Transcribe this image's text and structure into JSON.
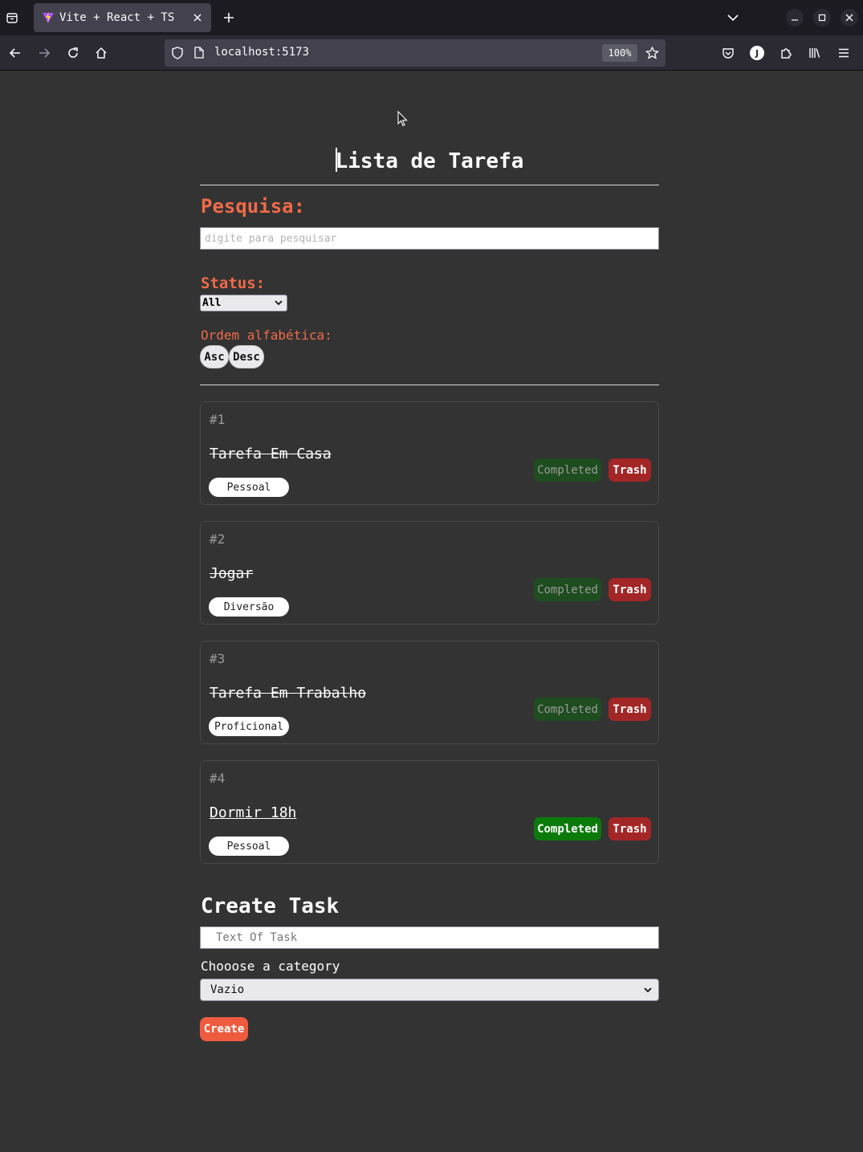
{
  "browser": {
    "tab_title": "Vite + React + TS",
    "url": "localhost:5173",
    "zoom": "100%",
    "account_initial": "J"
  },
  "page": {
    "title": "Lista de Tarefa",
    "search": {
      "label": "Pesquisa:",
      "placeholder": "digite para pesquisar",
      "value": ""
    },
    "status": {
      "label": "Status:",
      "selected": "All"
    },
    "sort": {
      "label": "Ordem alfabética:",
      "asc": "Asc",
      "desc": "Desc"
    },
    "tasks": [
      {
        "num": "#1",
        "title": "Tarefa Em Casa",
        "category": "Pessoal",
        "completed_label": "Completed",
        "trash_label": "Trash",
        "completed": true
      },
      {
        "num": "#2",
        "title": "Jogar",
        "category": "Diversão",
        "completed_label": "Completed",
        "trash_label": "Trash",
        "completed": true
      },
      {
        "num": "#3",
        "title": "Tarefa Em Trabalho",
        "category": "Proficional",
        "completed_label": "Completed",
        "trash_label": "Trash",
        "completed": true
      },
      {
        "num": "#4",
        "title": "Dormir 18h",
        "category": "Pessoal",
        "completed_label": "Completed",
        "trash_label": "Trash",
        "completed": false
      }
    ],
    "create": {
      "title": "Create Task",
      "input_placeholder": "Text Of Task",
      "category_label": "Chooose a category",
      "category_selected": "Vazio",
      "button": "Create"
    }
  },
  "colors": {
    "page_bg": "#333333",
    "accent_orange": "#ef6a48",
    "trash_red": "#a32626",
    "completed_dim": "#1e4d1f",
    "completed_active": "#0b7a0b",
    "create_button": "#ef5b3f"
  }
}
